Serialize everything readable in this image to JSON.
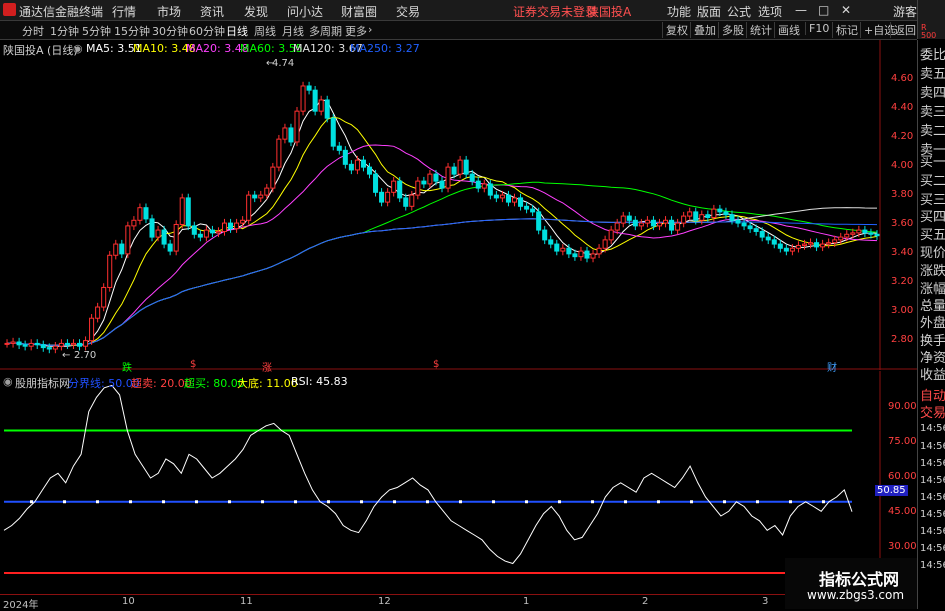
{
  "menubar": {
    "app_title": "通达信金融终端",
    "items": [
      "行情",
      "市场",
      "资讯",
      "发现",
      "问小达",
      "财富圈",
      "交易"
    ],
    "login_status": "证券交易未登录",
    "stock_name": "陕国投A",
    "right_items": [
      "功能",
      "版面",
      "公式",
      "选项"
    ],
    "guest": "游客",
    "minimize": "—",
    "maximize": "□",
    "close": "✕"
  },
  "toolbar": {
    "timeframes": [
      "分时",
      "1分钟",
      "5分钟",
      "15分钟",
      "30分钟",
      "60分钟",
      "日线",
      "周线",
      "月线",
      "多周期",
      "更多"
    ],
    "active_timeframe": "日线",
    "more_arrow": "›",
    "right_buttons": [
      "复权",
      "叠加",
      "多股",
      "统计",
      "画线",
      "F10",
      "标记",
      "+自选",
      "返回"
    ]
  },
  "rtop": {
    "r": "R",
    "num": "500"
  },
  "main_chart": {
    "title": "陕国投A (日线)",
    "ma": [
      {
        "label": "MA5: 3.51",
        "color": "#ffffff"
      },
      {
        "label": "MA10: 3.48",
        "color": "#ffff00"
      },
      {
        "label": "MA20: 3.48",
        "color": "#ff40ff"
      },
      {
        "label": "MA60: 3.55",
        "color": "#00ff00"
      },
      {
        "label": "MA120: 3.67",
        "color": "#e0e0e0"
      },
      {
        "label": "MA250: 3.27",
        "color": "#2060ff"
      }
    ],
    "y_ticks": [
      "4.60",
      "4.40",
      "4.20",
      "4.00",
      "3.80",
      "3.60",
      "3.40",
      "3.20",
      "3.00",
      "2.80"
    ],
    "high_label": "4.74",
    "low_label": "2.70",
    "events": [
      {
        "text": "跌",
        "color": "#00ff00"
      },
      {
        "text": "$",
        "color": "#ff4040"
      },
      {
        "text": "涨",
        "color": "#ff4040"
      },
      {
        "text": "$",
        "color": "#ff4040"
      },
      {
        "text": "财",
        "color": "#40a0ff"
      }
    ]
  },
  "indicator": {
    "title": "股朋指标网",
    "params": [
      {
        "label": "分界线: 50.00",
        "color": "#2050ff"
      },
      {
        "label": "超卖: 20.00",
        "color": "#ff4040"
      },
      {
        "label": "超买: 80.00",
        "color": "#00ff00"
      },
      {
        "label": "大底: 11.00",
        "color": "#ffff00"
      },
      {
        "label": "RSI: 45.83",
        "color": "#ffffff"
      }
    ],
    "y_ticks": [
      "90.00",
      "75.00",
      "60.00",
      "45.00",
      "30.00"
    ],
    "current_value": "50.85"
  },
  "x_axis": [
    "2024年",
    "10",
    "11",
    "12",
    "1",
    "2",
    "3"
  ],
  "right_panel": {
    "items": [
      "委比",
      "卖五",
      "卖四",
      "卖三",
      "卖二",
      "卖一",
      "买一",
      "买二",
      "买三",
      "买四",
      "买五",
      "现价",
      "涨跌",
      "涨幅",
      "总量",
      "外盘",
      "换手",
      "净资",
      "收益"
    ],
    "tabs": [
      "自动",
      "交易"
    ],
    "times": [
      "14:56",
      "14:56",
      "14:56",
      "14:56",
      "14:56",
      "14:56",
      "14:56",
      "14:56",
      "14:56"
    ]
  },
  "watermark": {
    "line1": "指标公式网",
    "line2": "www.zbgs3.com"
  },
  "chart_data": [
    {
      "type": "candlestick",
      "title": "陕国投A (日线)",
      "ylim": [
        2.65,
        4.78
      ],
      "close": [
        2.74,
        2.75,
        2.73,
        2.72,
        2.74,
        2.73,
        2.71,
        2.7,
        2.72,
        2.74,
        2.73,
        2.74,
        2.72,
        2.76,
        2.92,
        3.0,
        3.14,
        3.37,
        3.45,
        3.38,
        3.58,
        3.62,
        3.71,
        3.63,
        3.5,
        3.55,
        3.45,
        3.4,
        3.59,
        3.78,
        3.58,
        3.52,
        3.5,
        3.55,
        3.53,
        3.54,
        3.6,
        3.56,
        3.6,
        3.62,
        3.8,
        3.78,
        3.8,
        3.85,
        4.0,
        4.2,
        4.28,
        4.18,
        4.4,
        4.58,
        4.55,
        4.4,
        4.48,
        4.35,
        4.15,
        4.12,
        4.02,
        3.98,
        4.05,
        4.0,
        3.95,
        3.82,
        3.75,
        3.82,
        3.9,
        3.78,
        3.72,
        3.8,
        3.9,
        3.88,
        3.95,
        3.9,
        3.85,
        4.0,
        3.95,
        4.05,
        3.95,
        3.9,
        3.85,
        3.88,
        3.8,
        3.78,
        3.8,
        3.75,
        3.78,
        3.72,
        3.7,
        3.68,
        3.55,
        3.48,
        3.45,
        3.4,
        3.42,
        3.38,
        3.36,
        3.4,
        3.35,
        3.38,
        3.42,
        3.48,
        3.55,
        3.6,
        3.65,
        3.62,
        3.58,
        3.6,
        3.62,
        3.58,
        3.6,
        3.62,
        3.55,
        3.6,
        3.65,
        3.68,
        3.62,
        3.66,
        3.64,
        3.7,
        3.68,
        3.66,
        3.62,
        3.6,
        3.58,
        3.56,
        3.54,
        3.5,
        3.48,
        3.45,
        3.42,
        3.4,
        3.42,
        3.44,
        3.45,
        3.46,
        3.43,
        3.45,
        3.46,
        3.48,
        3.5,
        3.52,
        3.53,
        3.55,
        3.53,
        3.52,
        3.51
      ],
      "ma_periods": [
        5,
        10,
        20,
        60,
        120,
        250
      ],
      "ma_colors": [
        "#ffffff",
        "#ffff00",
        "#ff40ff",
        "#00ff00",
        "#e0e0e0",
        "#2060ff"
      ]
    },
    {
      "type": "line",
      "title": "股朋指标网",
      "ylim": [
        20,
        100
      ],
      "hlines": [
        {
          "value": 80,
          "color": "#00ff00"
        },
        {
          "value": 50,
          "color": "#2050ff"
        },
        {
          "value": 20,
          "color": "#ff2020"
        }
      ],
      "values": [
        38,
        40,
        43,
        47,
        50,
        55,
        60,
        62,
        58,
        65,
        70,
        88,
        94,
        98,
        99,
        95,
        80,
        70,
        65,
        60,
        62,
        68,
        66,
        62,
        70,
        68,
        64,
        60,
        62,
        65,
        68,
        72,
        78,
        80,
        82,
        83,
        80,
        78,
        70,
        62,
        55,
        50,
        48,
        45,
        40,
        38,
        37,
        42,
        48,
        52,
        55,
        56,
        58,
        60,
        57,
        55,
        50,
        46,
        42,
        40,
        38,
        36,
        34,
        30,
        27,
        25,
        24,
        28,
        34,
        40,
        45,
        48,
        44,
        38,
        34,
        35,
        40,
        45,
        52,
        56,
        58,
        56,
        54,
        60,
        62,
        60,
        58,
        56,
        60,
        65,
        58,
        52,
        48,
        44,
        46,
        50,
        48,
        44,
        42,
        38,
        40,
        36,
        44,
        48,
        50,
        48,
        46,
        50,
        52,
        55,
        45.83
      ]
    }
  ]
}
